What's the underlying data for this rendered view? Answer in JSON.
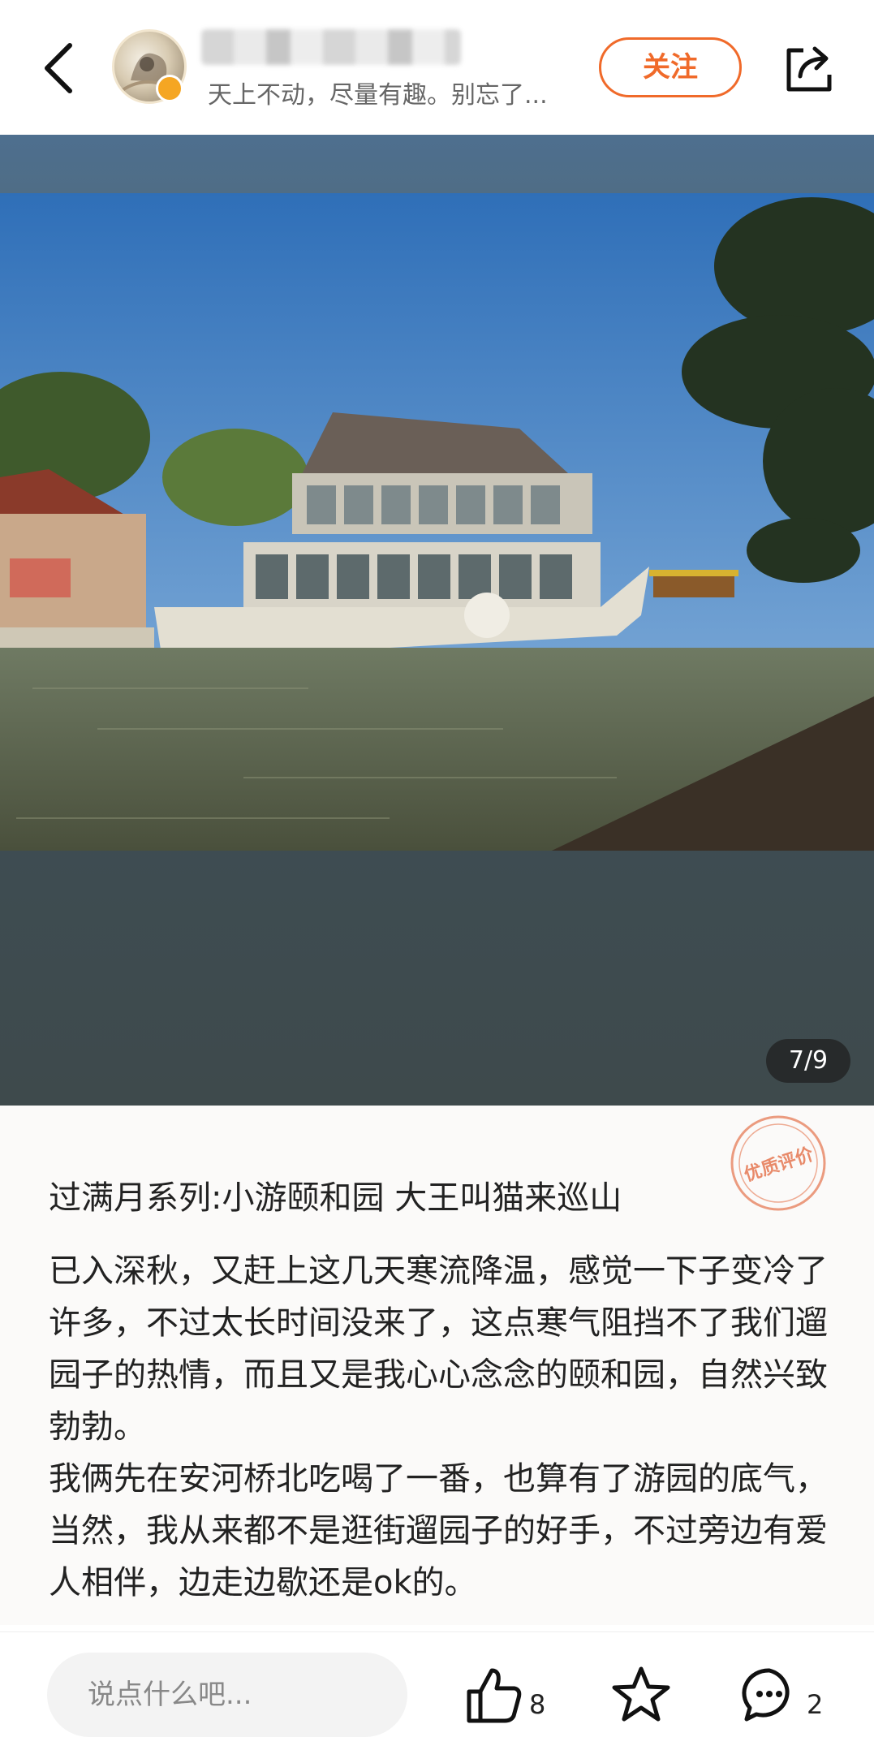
{
  "header": {
    "subtitle": "天上不动，尽量有趣。别忘了...",
    "follow_label": "关注",
    "icons": {
      "back": "back-arrow-icon",
      "share": "share-icon"
    }
  },
  "photo": {
    "description_hint": "Marble Boat at the Summer Palace",
    "page_indicator": "7/9"
  },
  "post": {
    "badge_text": "优质评价",
    "title": "过满月系列:小游颐和园 大王叫猫来巡山",
    "paragraphs": [
      "已入深秋，又赶上这几天寒流降温，感觉一下子变冷了许多，不过太长时间没来了，这点寒气阻挡不了我们遛园子的热情，而且又是我心心念念的颐和园，自然兴致勃勃。",
      "我俩先在安河桥北吃喝了一番，也算有了游园的底气，当然，我从来都不是逛街遛园子的好手，不过旁边有爱人相伴，边走边歇还是ok的。"
    ]
  },
  "bottom_bar": {
    "comment_placeholder": "说点什么吧...",
    "like_count": "8",
    "comment_count": "2",
    "icons": {
      "like": "thumbs-up-icon",
      "favorite": "star-icon",
      "comment": "comment-bubble-icon"
    }
  },
  "colors": {
    "accent": "#f06a2a",
    "stamp": "#e88a6a"
  }
}
